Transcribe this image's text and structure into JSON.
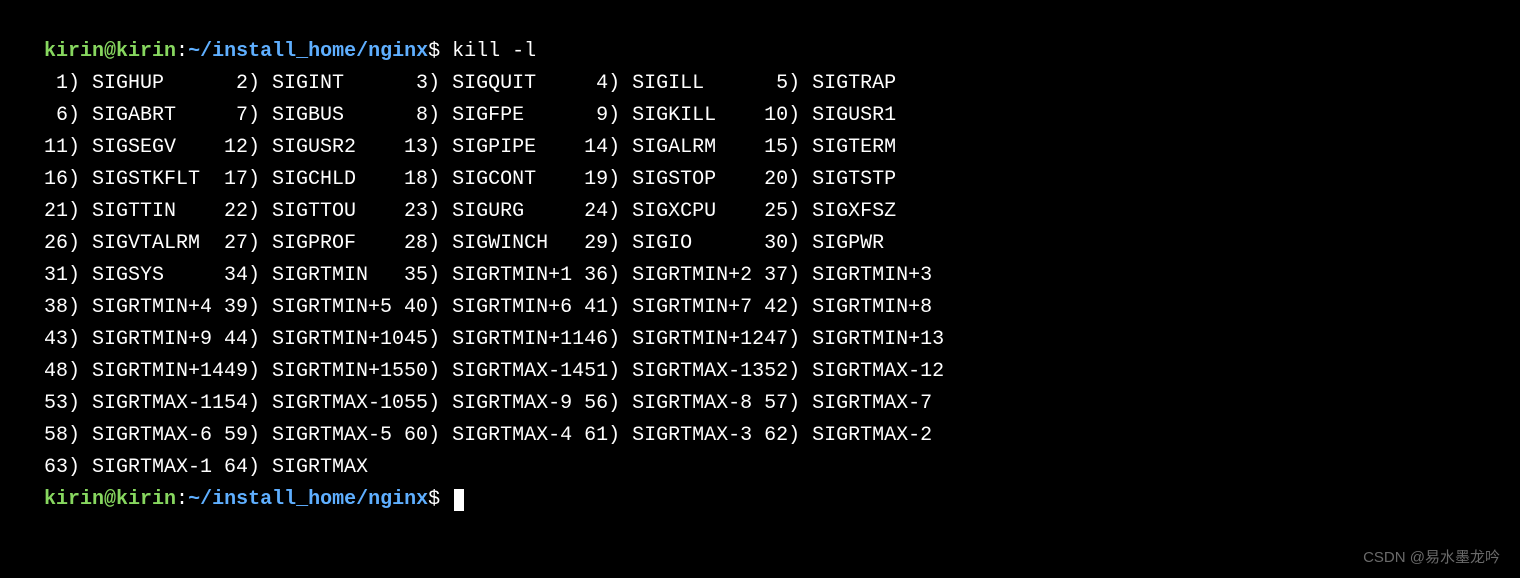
{
  "prompt1": {
    "user": "kirin",
    "at": "@",
    "host": "kirin",
    "colon": ":",
    "path": "~/install_home/nginx",
    "dollar": "$",
    "command": " kill -l"
  },
  "signals": [
    [
      {
        "n": "1",
        "name": "SIGHUP"
      },
      {
        "n": "2",
        "name": "SIGINT"
      },
      {
        "n": "3",
        "name": "SIGQUIT"
      },
      {
        "n": "4",
        "name": "SIGILL"
      },
      {
        "n": "5",
        "name": "SIGTRAP"
      }
    ],
    [
      {
        "n": "6",
        "name": "SIGABRT"
      },
      {
        "n": "7",
        "name": "SIGBUS"
      },
      {
        "n": "8",
        "name": "SIGFPE"
      },
      {
        "n": "9",
        "name": "SIGKILL"
      },
      {
        "n": "10",
        "name": "SIGUSR1"
      }
    ],
    [
      {
        "n": "11",
        "name": "SIGSEGV"
      },
      {
        "n": "12",
        "name": "SIGUSR2"
      },
      {
        "n": "13",
        "name": "SIGPIPE"
      },
      {
        "n": "14",
        "name": "SIGALRM"
      },
      {
        "n": "15",
        "name": "SIGTERM"
      }
    ],
    [
      {
        "n": "16",
        "name": "SIGSTKFLT"
      },
      {
        "n": "17",
        "name": "SIGCHLD"
      },
      {
        "n": "18",
        "name": "SIGCONT"
      },
      {
        "n": "19",
        "name": "SIGSTOP"
      },
      {
        "n": "20",
        "name": "SIGTSTP"
      }
    ],
    [
      {
        "n": "21",
        "name": "SIGTTIN"
      },
      {
        "n": "22",
        "name": "SIGTTOU"
      },
      {
        "n": "23",
        "name": "SIGURG"
      },
      {
        "n": "24",
        "name": "SIGXCPU"
      },
      {
        "n": "25",
        "name": "SIGXFSZ"
      }
    ],
    [
      {
        "n": "26",
        "name": "SIGVTALRM"
      },
      {
        "n": "27",
        "name": "SIGPROF"
      },
      {
        "n": "28",
        "name": "SIGWINCH"
      },
      {
        "n": "29",
        "name": "SIGIO"
      },
      {
        "n": "30",
        "name": "SIGPWR"
      }
    ],
    [
      {
        "n": "31",
        "name": "SIGSYS"
      },
      {
        "n": "34",
        "name": "SIGRTMIN"
      },
      {
        "n": "35",
        "name": "SIGRTMIN+1"
      },
      {
        "n": "36",
        "name": "SIGRTMIN+2"
      },
      {
        "n": "37",
        "name": "SIGRTMIN+3"
      }
    ],
    [
      {
        "n": "38",
        "name": "SIGRTMIN+4"
      },
      {
        "n": "39",
        "name": "SIGRTMIN+5"
      },
      {
        "n": "40",
        "name": "SIGRTMIN+6"
      },
      {
        "n": "41",
        "name": "SIGRTMIN+7"
      },
      {
        "n": "42",
        "name": "SIGRTMIN+8"
      }
    ],
    [
      {
        "n": "43",
        "name": "SIGRTMIN+9"
      },
      {
        "n": "44",
        "name": "SIGRTMIN+10"
      },
      {
        "n": "45",
        "name": "SIGRTMIN+11"
      },
      {
        "n": "46",
        "name": "SIGRTMIN+12"
      },
      {
        "n": "47",
        "name": "SIGRTMIN+13"
      }
    ],
    [
      {
        "n": "48",
        "name": "SIGRTMIN+14"
      },
      {
        "n": "49",
        "name": "SIGRTMIN+15"
      },
      {
        "n": "50",
        "name": "SIGRTMAX-14"
      },
      {
        "n": "51",
        "name": "SIGRTMAX-13"
      },
      {
        "n": "52",
        "name": "SIGRTMAX-12"
      }
    ],
    [
      {
        "n": "53",
        "name": "SIGRTMAX-11"
      },
      {
        "n": "54",
        "name": "SIGRTMAX-10"
      },
      {
        "n": "55",
        "name": "SIGRTMAX-9"
      },
      {
        "n": "56",
        "name": "SIGRTMAX-8"
      },
      {
        "n": "57",
        "name": "SIGRTMAX-7"
      }
    ],
    [
      {
        "n": "58",
        "name": "SIGRTMAX-6"
      },
      {
        "n": "59",
        "name": "SIGRTMAX-5"
      },
      {
        "n": "60",
        "name": "SIGRTMAX-4"
      },
      {
        "n": "61",
        "name": "SIGRTMAX-3"
      },
      {
        "n": "62",
        "name": "SIGRTMAX-2"
      }
    ],
    [
      {
        "n": "63",
        "name": "SIGRTMAX-1"
      },
      {
        "n": "64",
        "name": "SIGRTMAX"
      }
    ]
  ],
  "prompt2": {
    "user": "kirin",
    "at": "@",
    "host": "kirin",
    "colon": ":",
    "path": "~/install_home/nginx",
    "dollar": "$",
    "command": " "
  },
  "watermark": "CSDN @易水墨龙吟"
}
